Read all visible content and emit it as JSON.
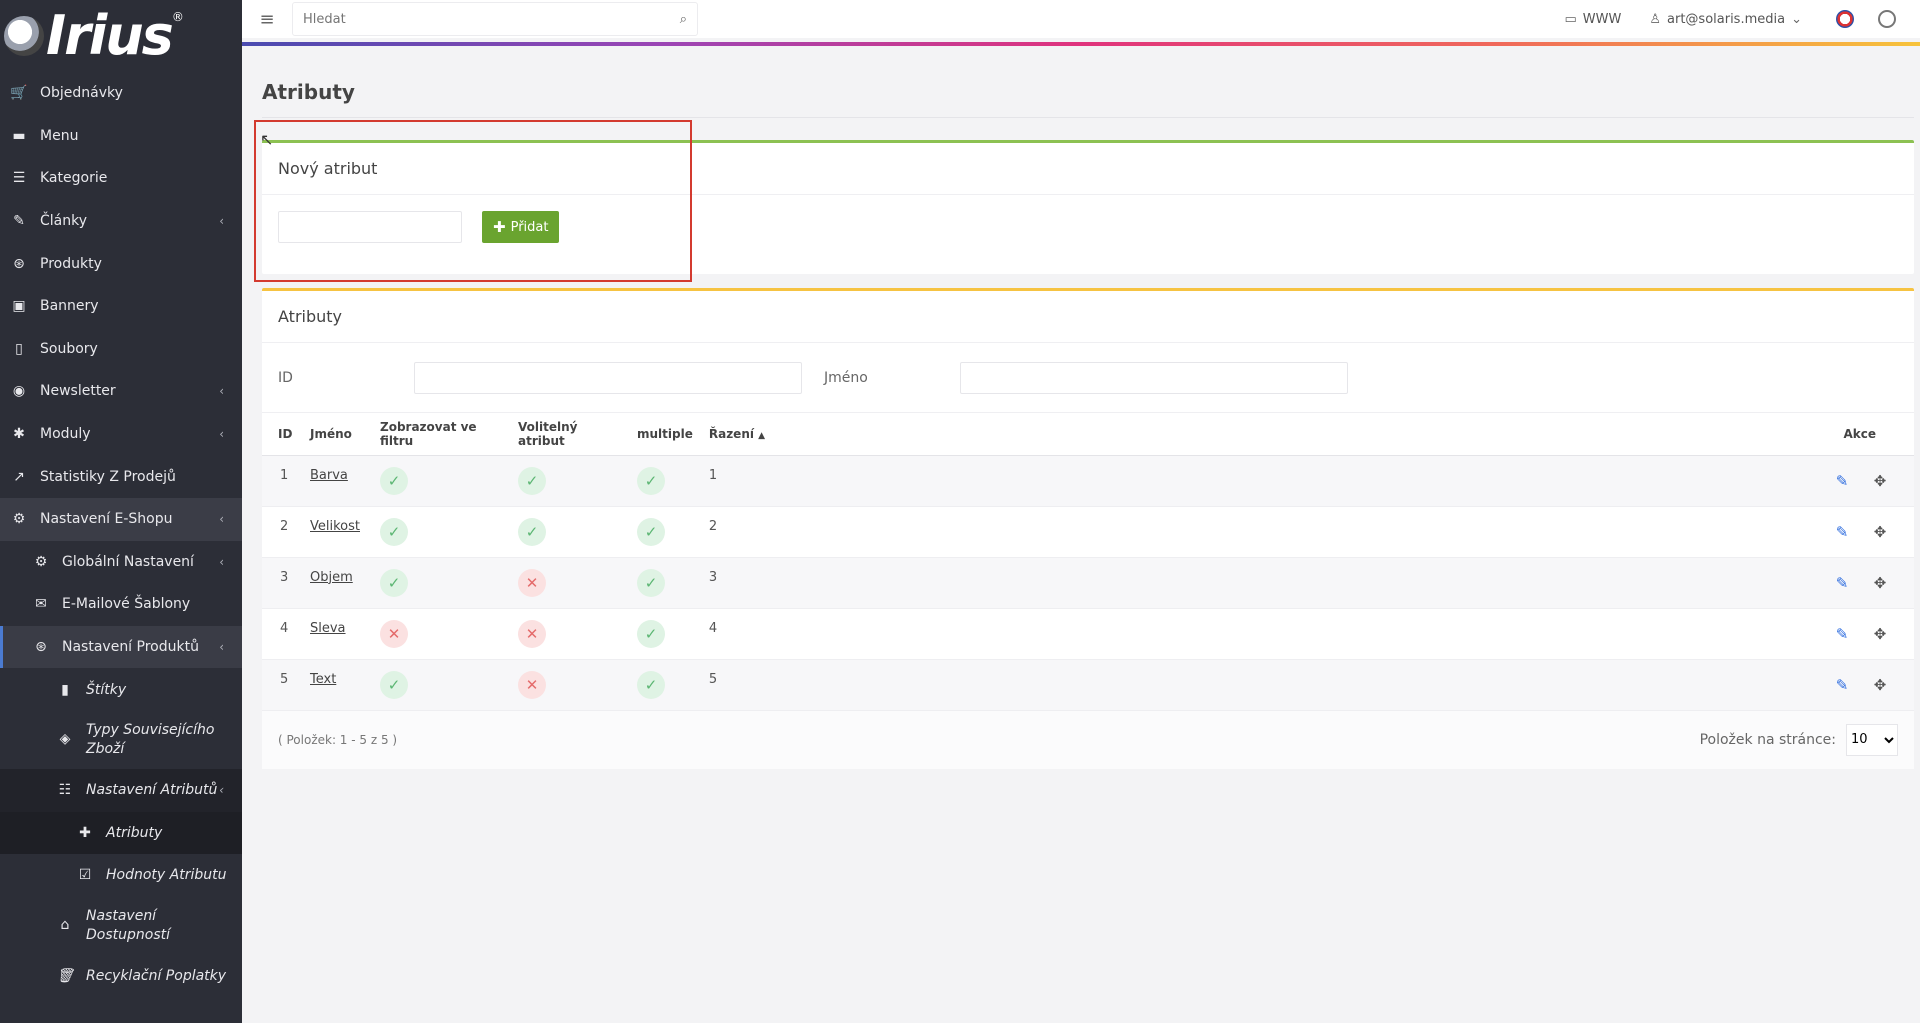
{
  "app": {
    "logo_text": "Irius",
    "logo_reg": "®"
  },
  "sidebar": {
    "items": [
      {
        "label": "Objednávky",
        "icon": "cart-icon"
      },
      {
        "label": "Menu",
        "icon": "folder-icon"
      },
      {
        "label": "Kategorie",
        "icon": "list-icon"
      },
      {
        "label": "Články",
        "icon": "pencil-icon",
        "chevron": "‹"
      },
      {
        "label": "Produkty",
        "icon": "dribbble-icon"
      },
      {
        "label": "Bannery",
        "icon": "image-icon"
      },
      {
        "label": "Soubory",
        "icon": "file-icon"
      },
      {
        "label": "Newsletter",
        "icon": "mail-icon",
        "chevron": "‹"
      },
      {
        "label": "Moduly",
        "icon": "puzzle-icon",
        "chevron": "‹"
      },
      {
        "label": "Statistiky Z Prodejů",
        "icon": "chart-icon"
      },
      {
        "label": "Nastavení E-Shopu",
        "icon": "gears-icon",
        "chevron": "‹"
      },
      {
        "label": "Globální Nastavení",
        "icon": "gear-icon",
        "chevron": "‹"
      },
      {
        "label": "E-Mailové Šablony",
        "icon": "envelope-icon"
      },
      {
        "label": "Nastavení Produktů",
        "icon": "dribbble-icon",
        "chevron": "‹"
      },
      {
        "label": "Štítky",
        "icon": "bookmark-icon"
      },
      {
        "label": "Typy Souvisejícího Zboží",
        "icon": "layers-icon"
      },
      {
        "label": "Nastavení Atributů",
        "icon": "sliders-icon",
        "chevron": "‹"
      },
      {
        "label": "Atributy",
        "icon": "plus-icon"
      },
      {
        "label": "Hodnoty Atributu",
        "icon": "checkbox-icon"
      },
      {
        "label": "Nastavení Dostupností",
        "icon": "home-icon"
      },
      {
        "label": "Recyklační Poplatky",
        "icon": "trash-icon"
      }
    ]
  },
  "topbar": {
    "search_placeholder": "Hledat",
    "www_label": "WWW",
    "user_label": "art@solaris.media"
  },
  "page": {
    "title": "Atributy"
  },
  "new_attr": {
    "title": "Nový atribut",
    "input_value": "",
    "add_label": "Přidat"
  },
  "list": {
    "title": "Atributy",
    "filter_id_label": "ID",
    "filter_name_label": "Jméno",
    "columns": {
      "id": "ID",
      "name": "Jméno",
      "filter": "Zobrazovat ve filtru",
      "optional": "Volitelný atribut",
      "multiple": "multiple",
      "order": "Řazení",
      "actions": "Akce"
    },
    "rows": [
      {
        "id": "1",
        "name": "Barva",
        "filter": true,
        "optional": true,
        "multiple": true,
        "order": "1"
      },
      {
        "id": "2",
        "name": "Velikost",
        "filter": true,
        "optional": true,
        "multiple": true,
        "order": "2"
      },
      {
        "id": "3",
        "name": "Objem",
        "filter": true,
        "optional": false,
        "multiple": true,
        "order": "3"
      },
      {
        "id": "4",
        "name": "Sleva",
        "filter": false,
        "optional": false,
        "multiple": true,
        "order": "4"
      },
      {
        "id": "5",
        "name": "Text",
        "filter": true,
        "optional": false,
        "multiple": true,
        "order": "5"
      }
    ],
    "footer_count": "( Položek: 1 - 5 z 5 )",
    "per_page_label": "Položek na stránce:",
    "per_page_value": "10"
  },
  "colors": {
    "sidebar_bg": "#2c2e37",
    "add_button": "#6aa42f",
    "new_card_border": "#8cc152",
    "list_card_border": "#f6c342",
    "highlight": "#d33a2f",
    "edit_icon": "#2d6cdf"
  }
}
